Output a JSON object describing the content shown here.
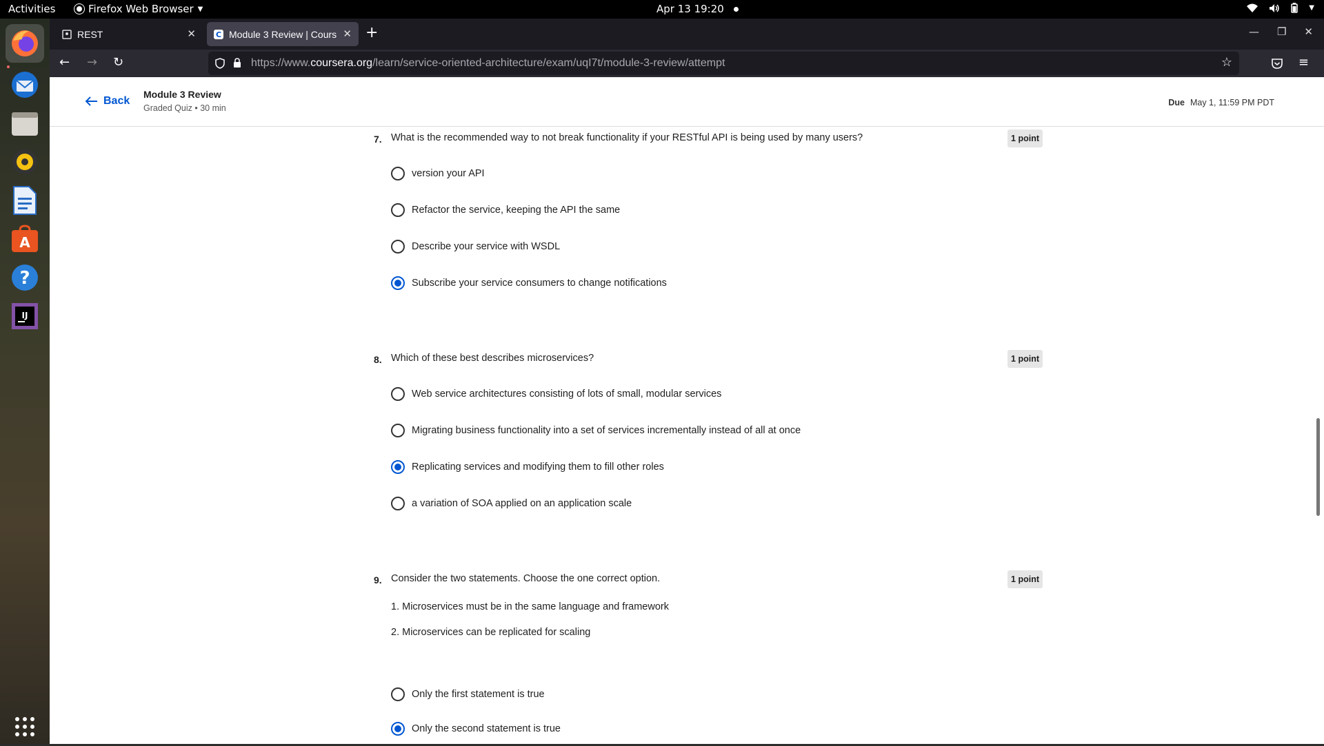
{
  "system": {
    "activities": "Activities",
    "app_name": "Firefox Web Browser",
    "clock": "Apr 13  19:20"
  },
  "dock": {
    "items": [
      "firefox-icon",
      "thunderbird-icon",
      "files-icon",
      "rhythmbox-icon",
      "writer-icon",
      "app-center-icon",
      "help-icon",
      "intellij-icon",
      "app-grid-icon"
    ]
  },
  "browser": {
    "tabs": [
      {
        "label": "REST",
        "active": false
      },
      {
        "label": "Module 3 Review | Cours",
        "active": true
      }
    ],
    "url_prefix": "https://www.",
    "url_domain": "coursera.org",
    "url_path": "/learn/service-oriented-architecture/exam/uqI7t/module-3-review/attempt"
  },
  "header": {
    "back_label": "Back",
    "title": "Module 3 Review",
    "subtitle": "Graded Quiz • 30 min",
    "due_label": "Due",
    "due_date": "May 1, 11:59 PM PDT"
  },
  "questions": [
    {
      "number": "7.",
      "text": "What is the recommended way to not break functionality if your RESTful API is being used by many users?",
      "points": "1 point",
      "options": [
        {
          "label": "version your API",
          "selected": false
        },
        {
          "label": "Refactor the service, keeping the API the same",
          "selected": false
        },
        {
          "label": "Describe your service with WSDL",
          "selected": false
        },
        {
          "label": "Subscribe your service consumers to change notifications",
          "selected": true
        }
      ]
    },
    {
      "number": "8.",
      "text": "Which of these best describes microservices?",
      "points": "1 point",
      "options": [
        {
          "label": "Web service architectures consisting of lots of small, modular services",
          "selected": false
        },
        {
          "label": "Migrating business functionality into a set of services incrementally instead of all at once",
          "selected": false
        },
        {
          "label": "Replicating services and modifying them to fill other roles",
          "selected": true
        },
        {
          "label": "a variation of SOA applied on an application scale",
          "selected": false
        }
      ]
    },
    {
      "number": "9.",
      "text": "Consider the two statements. Choose the one correct option.",
      "points": "1 point",
      "statements": [
        "1. Microservices must be in the same language and framework",
        "2. Microservices can be replicated for scaling"
      ],
      "options": [
        {
          "label": "Only the first statement is true",
          "selected": false
        },
        {
          "label": "Only the second statement is true",
          "selected": true
        }
      ]
    }
  ],
  "colors": {
    "accent": "#0056d2",
    "browser_dark": "#1c1b22"
  }
}
